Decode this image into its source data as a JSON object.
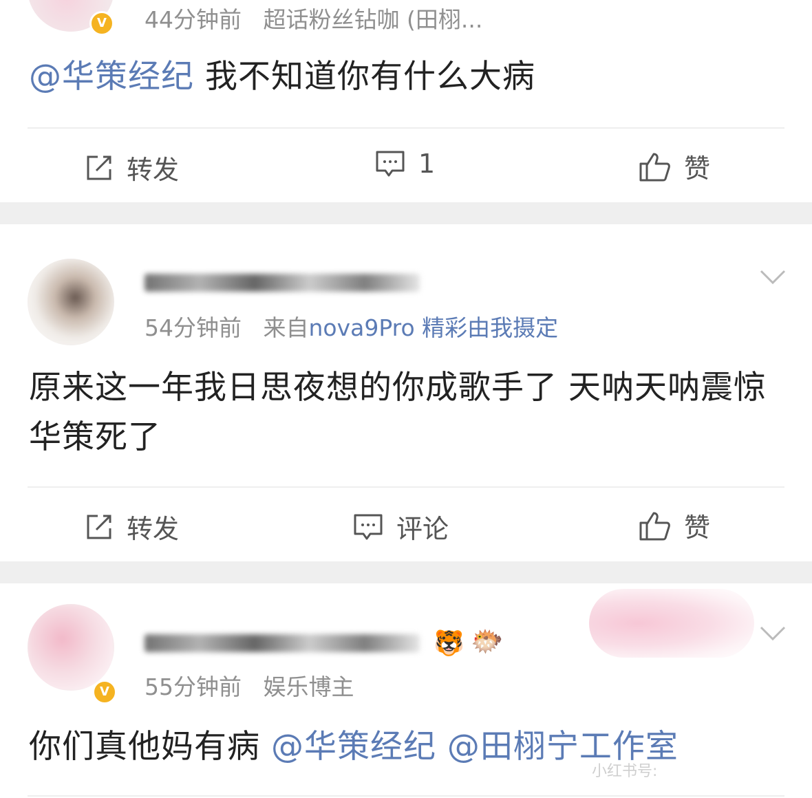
{
  "posts": [
    {
      "time": "44分钟前",
      "source": "超话粉丝钻咖 (田栩...",
      "mention": "@华策经纪",
      "body": "我不知道你有什么大病",
      "actions": {
        "repost": "转发",
        "comment": "1",
        "like": "赞"
      }
    },
    {
      "time": "54分钟前",
      "source_prefix": "来自",
      "source": "nova9Pro 精彩由我摄定",
      "body": "原来这一年我日思夜想的你成歌手了 天呐天呐震惊华策死了",
      "actions": {
        "repost": "转发",
        "comment": "评论",
        "like": "赞"
      }
    },
    {
      "time": "55分钟前",
      "source": "娱乐博主",
      "body": "你们真他妈有病",
      "mentions": [
        "@华策经纪",
        "@田栩宁工作室"
      ]
    }
  ],
  "watermark": "小红书号:",
  "colors": {
    "mention": "#5b7bb5",
    "meta": "#8f8f8f",
    "separator": "#efefef",
    "verified": "#f5b321"
  },
  "icons": [
    "repost-icon",
    "comment-icon",
    "like-icon",
    "chevron-down-icon",
    "verified-icon"
  ]
}
